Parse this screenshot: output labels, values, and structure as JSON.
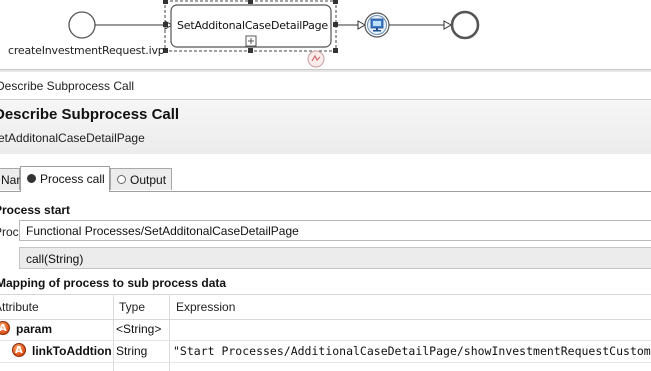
{
  "diagram": {
    "start_event_label": "createInvestmentRequest.ivp",
    "subprocess_label": "SetAdditonalCaseDetailPage"
  },
  "view": {
    "title": "Describe Subprocess Call"
  },
  "editor": {
    "title": "Describe Subprocess Call",
    "subtitle": "SetAdditonalCaseDetailPage"
  },
  "tabs": [
    {
      "label": "Name"
    },
    {
      "label": "Process call"
    },
    {
      "label": "Output"
    }
  ],
  "process_start": {
    "heading": "Process start",
    "field_label": "Process",
    "process_value": "Functional Processes/SetAdditonalCaseDetailPage",
    "signature": "call(String)"
  },
  "mapping": {
    "heading": "Mapping of process to sub process data",
    "columns": {
      "attribute": "Attribute",
      "type": "Type",
      "expression": "Expression"
    },
    "rows": [
      {
        "attribute": "param",
        "type": "<String>",
        "expression": ""
      },
      {
        "attribute": "linkToAddtion",
        "type": "String",
        "expression": "\"Start Processes/AdditionalCaseDetailPage/showInvestmentRequestCustom"
      }
    ]
  }
}
